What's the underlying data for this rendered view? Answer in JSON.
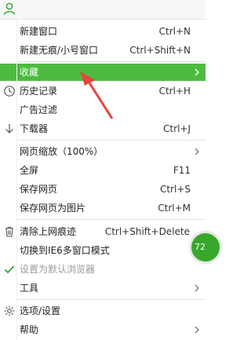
{
  "colors": {
    "highlight": "#4cbb3f",
    "annotation_arrow": "#e8453c",
    "check": "#2eaa2e",
    "badge": "#38a82c"
  },
  "topbar": {
    "icon": "user-icon"
  },
  "menu": {
    "new_window": {
      "label": "新建窗口",
      "shortcut": "Ctrl+N"
    },
    "new_private": {
      "label": "新建无痕/小号窗口",
      "shortcut": "Ctrl+Shift+N"
    },
    "favorites": {
      "label": "收藏"
    },
    "history": {
      "label": "历史记录",
      "shortcut": "Ctrl+H",
      "icon": "clock-icon"
    },
    "ad_filter": {
      "label": "广告过滤"
    },
    "downloads": {
      "label": "下载器",
      "shortcut": "Ctrl+J",
      "icon": "download-arrow-icon"
    },
    "zoom": {
      "label": "网页缩放（100%）"
    },
    "fullscreen": {
      "label": "全屏",
      "shortcut": "F11"
    },
    "save_page": {
      "label": "保存网页",
      "shortcut": "Ctrl+S"
    },
    "save_as_image": {
      "label": "保存网页为图片",
      "shortcut": "Ctrl+M"
    },
    "clear_traces": {
      "label": "清除上网痕迹",
      "shortcut": "Ctrl+Shift+Delete",
      "icon": "trash-icon"
    },
    "ie6_mode": {
      "label": "切换到IE6多窗口模式"
    },
    "set_default": {
      "label": "设置为默认浏览器",
      "icon": "check-icon"
    },
    "tools": {
      "label": "工具"
    },
    "options": {
      "label": "选项/设置",
      "icon": "gear-icon"
    },
    "help": {
      "label": "帮助"
    }
  },
  "badge": {
    "text": "72"
  }
}
